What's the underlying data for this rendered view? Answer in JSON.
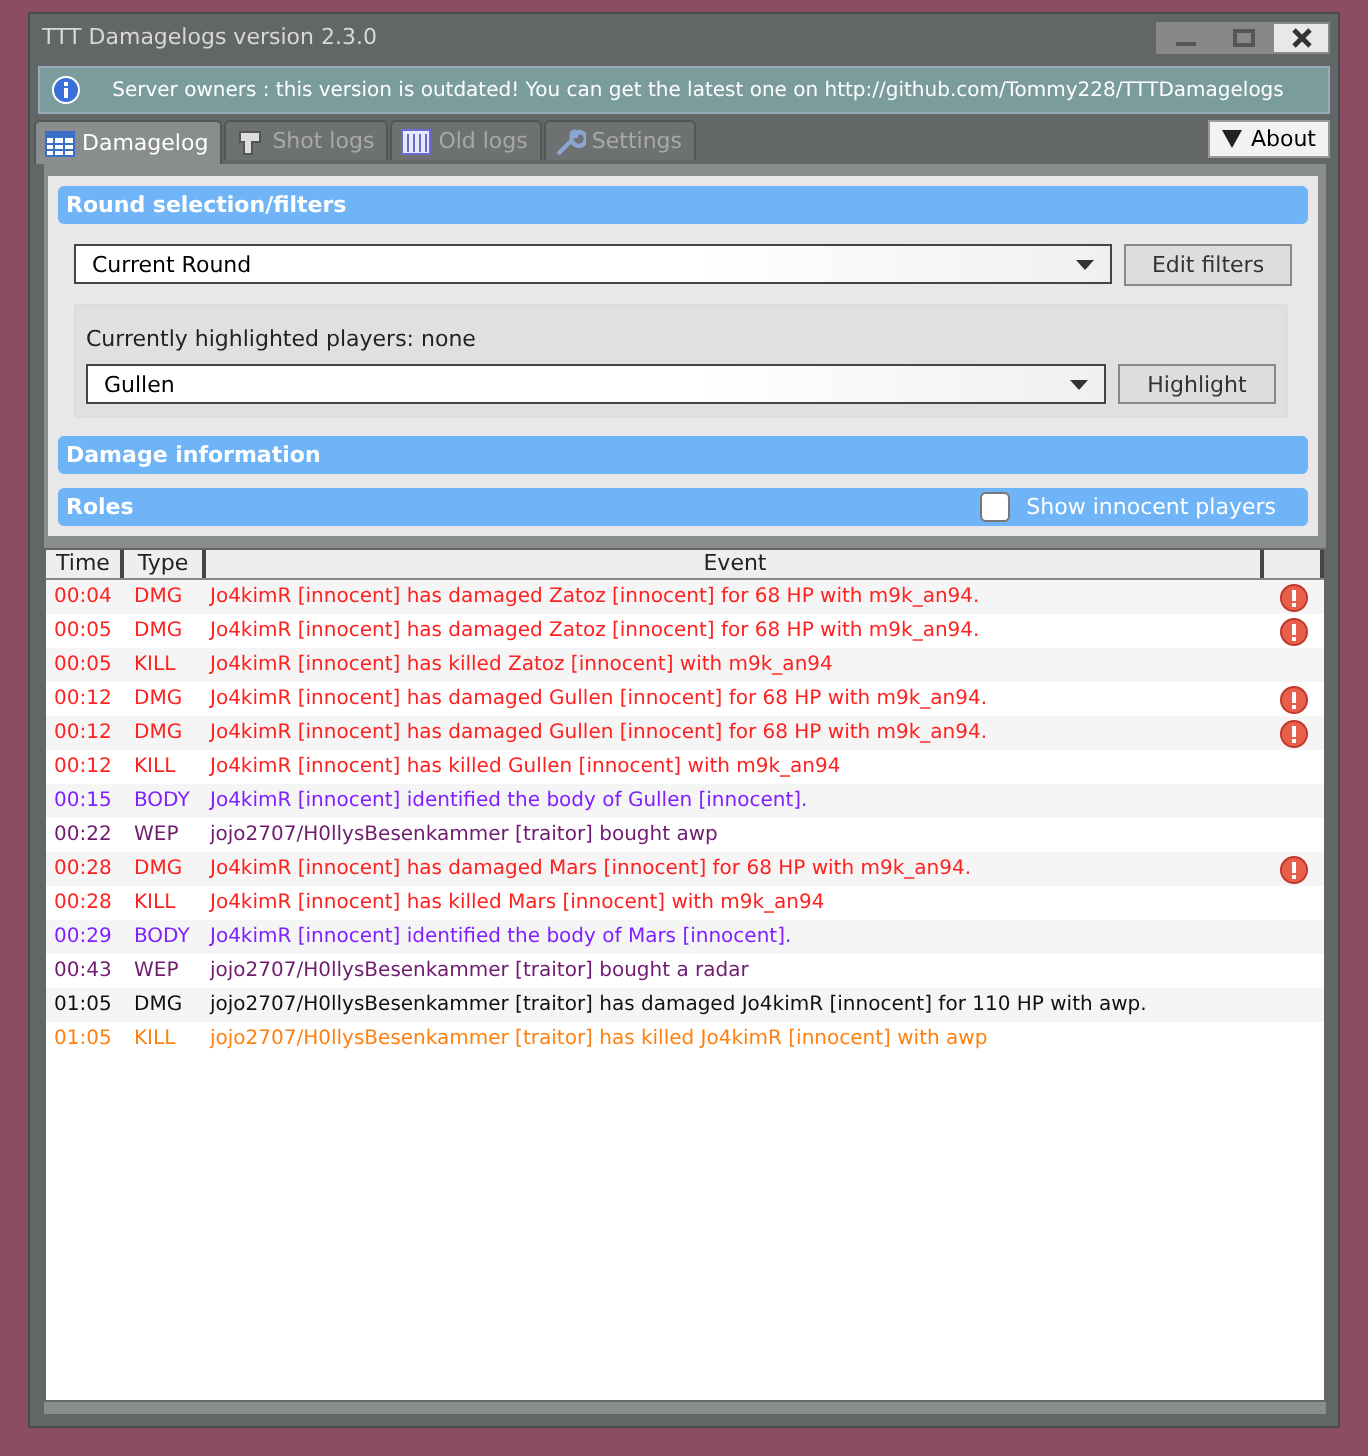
{
  "window": {
    "title": "TTT Damagelogs version 2.3.0"
  },
  "notice": "Server owners : this version is outdated! You can get the latest one on http://github.com/Tommy228/TTTDamagelogs",
  "tabs": [
    {
      "label": "Damagelog",
      "selected": true
    },
    {
      "label": "Shot logs",
      "selected": false
    },
    {
      "label": "Old logs",
      "selected": false
    },
    {
      "label": "Settings",
      "selected": false
    }
  ],
  "about_button": "About",
  "filters": {
    "title": "Round selection/filters",
    "round": "Current Round",
    "edit_button": "Edit filters",
    "highlighted_label": "Currently highlighted players: none",
    "player": "Gullen",
    "highlight_button": "Highlight"
  },
  "damage_section": {
    "title": "Damage information"
  },
  "roles_section": {
    "title": "Roles",
    "show_innocent": {
      "label": "Show innocent players",
      "checked": false
    }
  },
  "table": {
    "columns": [
      "Time",
      "Type",
      "Event"
    ],
    "rows": [
      {
        "time": "00:04",
        "type": "DMG",
        "event": "Jo4kimR [innocent] has damaged Zatoz [innocent] for 68 HP with m9k_an94.",
        "color": "#ff2020",
        "warning": true
      },
      {
        "time": "00:05",
        "type": "DMG",
        "event": "Jo4kimR [innocent] has damaged Zatoz [innocent] for 68 HP with m9k_an94.",
        "color": "#ff2020",
        "warning": true
      },
      {
        "time": "00:05",
        "type": "KILL",
        "event": "Jo4kimR [innocent] has killed Zatoz [innocent] with m9k_an94",
        "color": "#ff2020",
        "warning": false
      },
      {
        "time": "00:12",
        "type": "DMG",
        "event": "Jo4kimR [innocent] has damaged Gullen [innocent] for 68 HP with m9k_an94.",
        "color": "#ff2020",
        "warning": true
      },
      {
        "time": "00:12",
        "type": "DMG",
        "event": "Jo4kimR [innocent] has damaged Gullen [innocent] for 68 HP with m9k_an94.",
        "color": "#ff2020",
        "warning": true
      },
      {
        "time": "00:12",
        "type": "KILL",
        "event": "Jo4kimR [innocent] has killed Gullen [innocent] with m9k_an94",
        "color": "#ff2020",
        "warning": false
      },
      {
        "time": "00:15",
        "type": "BODY",
        "event": "Jo4kimR [innocent] identified the body of Gullen [innocent].",
        "color": "#8020ff",
        "warning": false
      },
      {
        "time": "00:22",
        "type": "WEP",
        "event": "jojo2707/H0llysBesenkammer [traitor] bought awp",
        "color": "#701a70",
        "warning": false
      },
      {
        "time": "00:28",
        "type": "DMG",
        "event": "Jo4kimR [innocent] has damaged Mars [innocent] for 68 HP with m9k_an94.",
        "color": "#ff2020",
        "warning": true
      },
      {
        "time": "00:28",
        "type": "KILL",
        "event": "Jo4kimR [innocent] has killed Mars [innocent] with m9k_an94",
        "color": "#ff2020",
        "warning": false
      },
      {
        "time": "00:29",
        "type": "BODY",
        "event": "Jo4kimR [innocent] identified the body of Mars [innocent].",
        "color": "#8020ff",
        "warning": false
      },
      {
        "time": "00:43",
        "type": "WEP",
        "event": "jojo2707/H0llysBesenkammer [traitor] bought a radar",
        "color": "#701a70",
        "warning": false
      },
      {
        "time": "01:05",
        "type": "DMG",
        "event": "jojo2707/H0llysBesenkammer [traitor] has damaged Jo4kimR [innocent] for 110 HP with awp.",
        "color": "#101010",
        "warning": false
      },
      {
        "time": "01:05",
        "type": "KILL",
        "event": "jojo2707/H0llysBesenkammer [traitor] has killed Jo4kimR [innocent] with awp",
        "color": "#ff8010",
        "warning": false
      }
    ]
  }
}
